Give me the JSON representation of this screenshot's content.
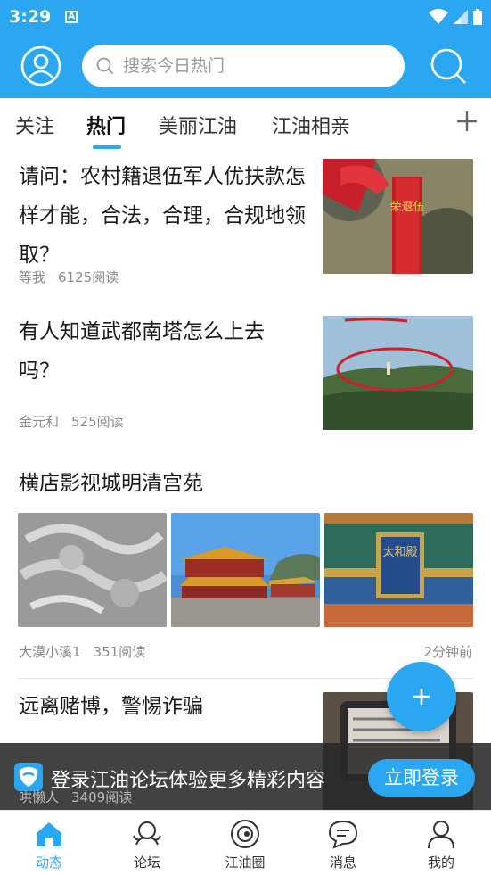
{
  "status_bar": {
    "time": "3:29",
    "notif_badge": "A"
  },
  "header": {
    "search_placeholder": "搜索今日热门",
    "accent": "#2aa7f0"
  },
  "tabs": [
    {
      "label": "关注",
      "active": false
    },
    {
      "label": "热门",
      "active": true
    },
    {
      "label": "美丽江油",
      "active": false
    },
    {
      "label": "江油相亲",
      "active": false
    }
  ],
  "posts": [
    {
      "title": "请问：农村籍退伍军人优扶款怎样才能，合法，合理，合规地领取？",
      "author": "等我",
      "reads": "6125阅读"
    },
    {
      "title": "有人知道武都南塔怎么上去吗？",
      "author": "金元和",
      "reads": "525阅读"
    },
    {
      "title": "横店影视城明清宫苑",
      "author": "大漠小溪1",
      "reads": "351阅读",
      "time": "2分钟前"
    },
    {
      "title": "远离赌博，警惕诈骗",
      "author": "哄懒人",
      "reads": "3409阅读"
    }
  ],
  "image_text": {
    "badge": "荣退伍",
    "plaque": "太和殿"
  },
  "login_banner": {
    "text": "登录江油论坛体验更多精彩内容",
    "button": "立即登录"
  },
  "bottom_nav": [
    {
      "label": "动态",
      "icon": "home-icon",
      "active": true
    },
    {
      "label": "论坛",
      "icon": "forum-icon",
      "active": false
    },
    {
      "label": "江油圈",
      "icon": "circle-icon",
      "active": false
    },
    {
      "label": "消息",
      "icon": "message-icon",
      "active": false
    },
    {
      "label": "我的",
      "icon": "profile-icon",
      "active": false
    }
  ]
}
